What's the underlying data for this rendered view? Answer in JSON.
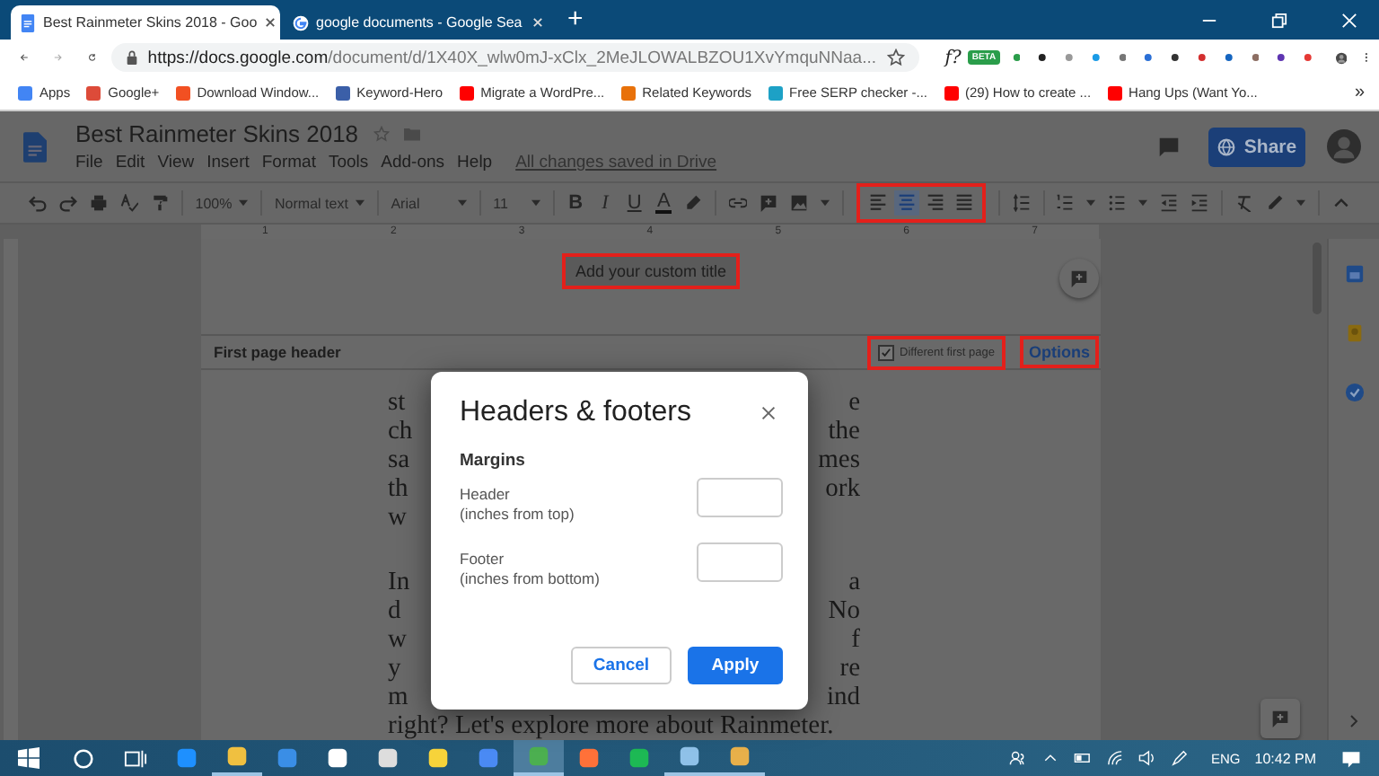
{
  "browser": {
    "tabs": [
      {
        "title": "Best Rainmeter Skins 2018 - Goo",
        "kind": "docs",
        "selected": true
      },
      {
        "title": "google documents - Google Sea",
        "kind": "google",
        "selected": false
      }
    ],
    "new_tab": "+",
    "url": {
      "host": "https://docs.google.com",
      "path": "/document/d/1X40X_wlw0mJ-xClx_2MeJLOWALBZOU1XvYmquNNaa..."
    },
    "extension_text": "f?",
    "beta_badge": "BETA",
    "bookmarks": [
      {
        "label": "Apps",
        "color": "#4285f4"
      },
      {
        "label": "Google+",
        "color": "#dd4b39"
      },
      {
        "label": "Download Window...",
        "color": "#f25022"
      },
      {
        "label": "Keyword-Hero",
        "color": "#3b5fa8"
      },
      {
        "label": "Migrate a WordPre...",
        "color": "#ff0000"
      },
      {
        "label": "Related Keywords",
        "color": "#e8710a"
      },
      {
        "label": "Free SERP checker -...",
        "color": "#1da1c6"
      },
      {
        "label": "(29) How to create ...",
        "color": "#ff0000"
      },
      {
        "label": "Hang Ups (Want Yo...",
        "color": "#ff0000"
      }
    ],
    "more_bookmarks": "»"
  },
  "docs": {
    "title": "Best Rainmeter Skins 2018",
    "menus": [
      "File",
      "Edit",
      "View",
      "Insert",
      "Format",
      "Tools",
      "Add-ons",
      "Help"
    ],
    "save_status": "All changes saved in Drive",
    "share": "Share",
    "toolbar": {
      "zoom": "100%",
      "style": "Normal text",
      "font": "Arial",
      "size": "11",
      "format": [
        "B",
        "I",
        "U",
        "A"
      ],
      "alignments": [
        {
          "selected": false
        },
        {
          "selected": true
        },
        {
          "selected": false
        },
        {
          "selected": false
        }
      ]
    },
    "ruler": [
      "1",
      "2",
      "3",
      "4",
      "5",
      "6",
      "7"
    ],
    "header_title": "Add your custom title",
    "header_label": "First page header",
    "different_first_page": {
      "label": "Different first page",
      "checked": true
    },
    "options": "Options",
    "paragraphs": [
      {
        "lines": [
          {
            "kind": "split",
            "left": "st",
            "right": "e"
          },
          {
            "kind": "split",
            "left": "ch",
            "right": "the"
          },
          {
            "kind": "split",
            "left": "sa",
            "right": "mes"
          },
          {
            "kind": "split",
            "left": "th",
            "right": "ork"
          },
          {
            "kind": "split",
            "left": "w"
          }
        ]
      },
      {
        "lines": [
          {
            "kind": "split",
            "left": "In",
            "right": "a"
          },
          {
            "kind": "split",
            "left": "d",
            "right": "No"
          },
          {
            "kind": "split",
            "left": "w",
            "right": "f"
          },
          {
            "kind": "split",
            "left": "y",
            "right": "re"
          },
          {
            "kind": "split",
            "left": "m",
            "right": "ind"
          },
          {
            "kind": "full",
            "text": "right? Let's explore more about Rainmeter."
          }
        ]
      }
    ]
  },
  "dialog": {
    "title": "Headers & footers",
    "section": "Margins",
    "fields": [
      {
        "label": "Header",
        "hint": "(inches from top)"
      },
      {
        "label": "Footer",
        "hint": "(inches from bottom)"
      }
    ],
    "buttons": [
      {
        "label": "Cancel",
        "kind": "secondary"
      },
      {
        "label": "Apply",
        "kind": "primary"
      }
    ]
  },
  "taskbar": {
    "apps": [
      {
        "color": "#1e90ff",
        "running": false,
        "selected": false
      },
      {
        "color": "#f0c040",
        "running": true,
        "selected": false
      },
      {
        "color": "#3a8ee6",
        "running": false,
        "selected": false
      },
      {
        "color": "#ffffff",
        "running": false,
        "selected": false
      },
      {
        "color": "#dddddd",
        "running": false,
        "selected": false
      },
      {
        "color": "#f7d33a",
        "running": false,
        "selected": false
      },
      {
        "color": "#4a8af4",
        "running": false,
        "selected": false
      },
      {
        "color": "#4caf50",
        "running": true,
        "selected": true
      },
      {
        "color": "#ff7139",
        "running": false,
        "selected": false
      },
      {
        "color": "#1db954",
        "running": false,
        "selected": false
      },
      {
        "color": "#8fc1e8",
        "running": true,
        "selected": false
      },
      {
        "color": "#e8b04a",
        "running": true,
        "selected": false
      }
    ],
    "language": "ENG",
    "time": "10:42 PM"
  }
}
